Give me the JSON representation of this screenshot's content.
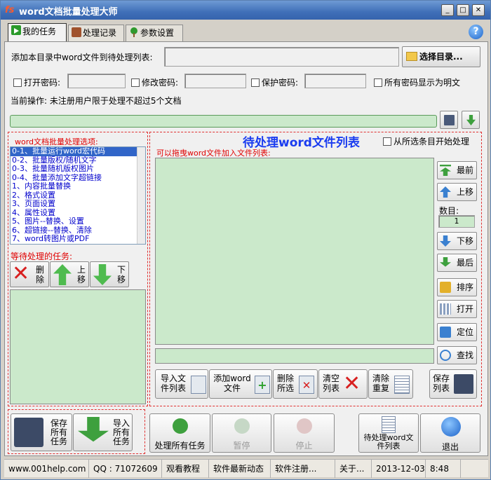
{
  "app": {
    "title": "word文档批量处理大师",
    "logo": "fs-logo-icon"
  },
  "window_buttons": [
    "_",
    "□",
    "✕"
  ],
  "help": "?",
  "tabs": [
    {
      "label": "我的任务",
      "icon": "play-icon"
    },
    {
      "label": "处理记录",
      "icon": "briefcase-icon"
    },
    {
      "label": "参数设置",
      "icon": "tree-icon"
    }
  ],
  "add_dir": {
    "label": "添加本目录中word文件到待处理列表:",
    "value": "",
    "button": "选择目录..."
  },
  "passwords": {
    "open": "打开密码:",
    "modify": "修改密码:",
    "protect": "保护密码:",
    "show_plain": "所有密码显示为明文"
  },
  "current_op": "当前操作: 未注册用户限于处理不超过5个文档",
  "options": {
    "title": "word文档批量处理选项:",
    "items": [
      "0-1、批量运行word宏代码",
      "0-2、批量版权/随机文字",
      "0-3、批量随机版权图片",
      "0-4、批量添加文字超链接",
      "1、内容批量替换",
      "2、格式设置",
      "3、页面设置",
      "4、属性设置",
      "5、图片--替换、设置",
      "6、超链接--替换、清除",
      "7、word转图片或PDF"
    ],
    "selected": 0
  },
  "waiting": {
    "title": "等待处理的任务:",
    "delete": "删除",
    "up": "上移",
    "down": "下移"
  },
  "file_list": {
    "title": "待处理word文件列表",
    "start_from_selected": "从所选条目开始处理",
    "drag_hint": "可以拖曳word文件加入文件列表:"
  },
  "side": {
    "top": "最前",
    "up": "上移",
    "count_label": "数目:",
    "count": "1",
    "down": "下移",
    "bottom": "最后",
    "sort": "排序",
    "open": "打开",
    "locate": "定位",
    "find": "查找"
  },
  "file_buttons": {
    "import": "导入文件列表",
    "add": "添加word文件",
    "delete": "删除所选",
    "clear": "清空列表",
    "dedupe": "清除重复",
    "save": "保存列表"
  },
  "bottom": {
    "save_all": "保存所有任务",
    "import_all": "导入所有任务",
    "process_all": "处理所有任务",
    "pause": "暂停",
    "stop": "停止",
    "pending_list": "待处理word文件列表",
    "exit": "退出"
  },
  "status": {
    "site": "www.001help.com",
    "qq": "QQ : 71072609",
    "tutorial": "观看教程",
    "news": "软件最新动态",
    "register": "软件注册...",
    "about": "关于...",
    "date": "2013-12-03",
    "time": "8:48"
  }
}
